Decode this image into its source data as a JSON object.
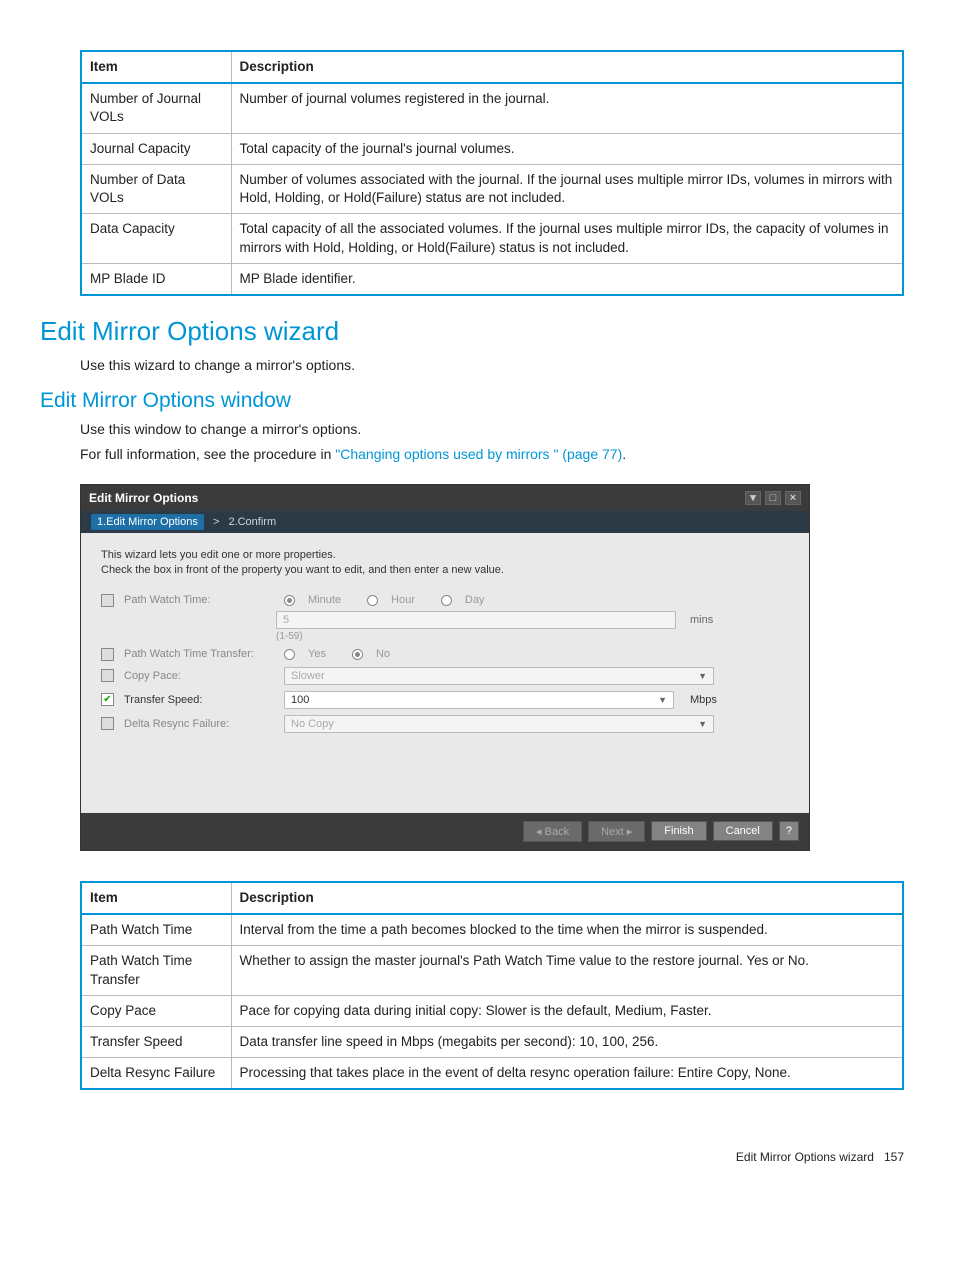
{
  "table1": {
    "headers": [
      "Item",
      "Description"
    ],
    "rows": [
      [
        "Number of Journal VOLs",
        "Number of journal volumes registered in the journal."
      ],
      [
        "Journal Capacity",
        "Total capacity of the journal's journal volumes."
      ],
      [
        "Number of Data VOLs",
        "Number of volumes associated with the journal. If the journal uses multiple mirror IDs, volumes in mirrors with Hold, Holding, or Hold(Failure) status are not included."
      ],
      [
        "Data Capacity",
        "Total capacity of all the associated volumes. If the journal uses multiple mirror IDs, the capacity of volumes in mirrors with Hold, Holding, or Hold(Failure) status is not included."
      ],
      [
        "MP Blade ID",
        "MP Blade identifier."
      ]
    ]
  },
  "section1": {
    "heading": "Edit Mirror Options wizard",
    "para": "Use this wizard to change a mirror's options."
  },
  "section2": {
    "heading": "Edit Mirror Options window",
    "para1": "Use this window to change a mirror's options.",
    "para2_pre": "For full information, see the procedure in ",
    "para2_link": "\"Changing options used by mirrors \" (page 77)",
    "para2_post": "."
  },
  "wizard": {
    "title": "Edit Mirror Options",
    "step1": "1.Edit Mirror Options",
    "stepSep": ">",
    "step2": "2.Confirm",
    "intro1": "This wizard lets you edit one or more properties.",
    "intro2": "Check the box in front of the property you want to edit, and then enter a new value.",
    "rows": {
      "pwt": {
        "label": "Path Watch Time:",
        "r1": "Minute",
        "r2": "Hour",
        "r3": "Day",
        "value": "5",
        "unit": "mins",
        "range": "(1-59)"
      },
      "pwtt": {
        "label": "Path Watch Time Transfer:",
        "r1": "Yes",
        "r2": "No"
      },
      "cp": {
        "label": "Copy Pace:",
        "value": "Slower"
      },
      "ts": {
        "label": "Transfer Speed:",
        "value": "100",
        "unit": "Mbps"
      },
      "drf": {
        "label": "Delta Resync Failure:",
        "value": "No Copy"
      }
    },
    "buttons": {
      "back": "◂ Back",
      "next": "Next ▸",
      "finish": "Finish",
      "cancel": "Cancel",
      "help": "?"
    }
  },
  "table2": {
    "headers": [
      "Item",
      "Description"
    ],
    "rows": [
      [
        "Path Watch Time",
        "Interval from the time a path becomes blocked to the time when the mirror is suspended."
      ],
      [
        "Path Watch Time Transfer",
        "Whether to assign the master journal's Path Watch Time value to the restore journal. Yes or No."
      ],
      [
        "Copy Pace",
        "Pace for copying data during initial copy: Slower is the default, Medium, Faster."
      ],
      [
        "Transfer Speed",
        "Data transfer line speed in Mbps (megabits per second): 10, 100, 256."
      ],
      [
        "Delta Resync Failure",
        "Processing that takes place in the event of delta resync operation failure: Entire Copy, None."
      ]
    ]
  },
  "footer": {
    "text": "Edit Mirror Options wizard",
    "page": "157"
  }
}
